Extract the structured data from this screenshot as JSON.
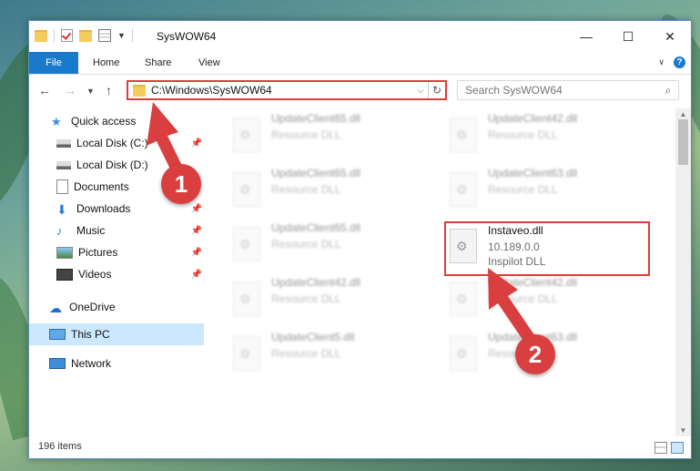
{
  "window": {
    "title": "SysWOW64",
    "controls": [
      "—",
      "☐",
      "✕"
    ]
  },
  "ribbon": {
    "tabs": [
      "File",
      "Home",
      "Share",
      "View"
    ]
  },
  "nav": {
    "address": "C:\\Windows\\SysWOW64",
    "search_placeholder": "Search SysWOW64"
  },
  "sidebar": {
    "items": [
      {
        "label": "Quick access",
        "icon": "star-icon"
      },
      {
        "label": "Local Disk (C:)",
        "icon": "drive-icon"
      },
      {
        "label": "Local Disk (D:)",
        "icon": "drive-icon"
      },
      {
        "label": "Documents",
        "icon": "documents-icon"
      },
      {
        "label": "Downloads",
        "icon": "download-icon"
      },
      {
        "label": "Music",
        "icon": "music-icon"
      },
      {
        "label": "Pictures",
        "icon": "pictures-icon"
      },
      {
        "label": "Videos",
        "icon": "videos-icon"
      },
      {
        "label": "OneDrive",
        "icon": "cloud-icon"
      },
      {
        "label": "This PC",
        "icon": "computer-icon"
      },
      {
        "label": "Network",
        "icon": "network-icon"
      }
    ]
  },
  "files": [
    {
      "name": "UpdateClient65.dll",
      "sub1": "Resource DLL",
      "sub2": ""
    },
    {
      "name": "UpdateClient42.dll",
      "sub1": "Resource DLL",
      "sub2": ""
    },
    {
      "name": "UpdateClient65.dll",
      "sub1": "Resource DLL",
      "sub2": ""
    },
    {
      "name": "UpdateClient63.dll",
      "sub1": "Resource DLL",
      "sub2": ""
    },
    {
      "name": "UpdateClient65.dll",
      "sub1": "Resource DLL",
      "sub2": ""
    },
    {
      "name": "Instaveo.dll",
      "sub1": "10.189.0.0",
      "sub2": "Inspilot DLL"
    },
    {
      "name": "UpdateClient42.dll",
      "sub1": "Resource DLL",
      "sub2": ""
    },
    {
      "name": "UpdateClient42.dll",
      "sub1": "Resource DLL",
      "sub2": ""
    },
    {
      "name": "UpdateClient5.dll",
      "sub1": "Resource DLL",
      "sub2": ""
    },
    {
      "name": "UpdateClient63.dll",
      "sub1": "Resource DLL",
      "sub2": ""
    }
  ],
  "status": {
    "item_count": "196 items"
  },
  "annotations": {
    "step1": "1",
    "step2": "2",
    "color": "#d93f3f"
  }
}
